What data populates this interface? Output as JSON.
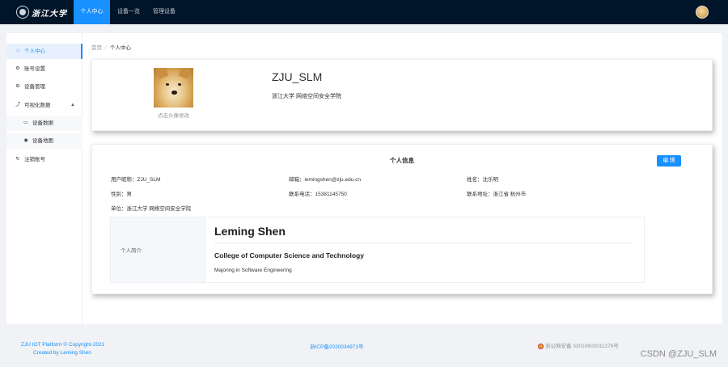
{
  "nav": {
    "logo_text": "浙江大学",
    "items": [
      "个人中心",
      "设备一览",
      "管理设备"
    ]
  },
  "sidebar": {
    "items": [
      {
        "label": "个人中心",
        "icon": "home-icon"
      },
      {
        "label": "账号设置",
        "icon": "gear-icon"
      },
      {
        "label": "设备管理",
        "icon": "gear-icon"
      },
      {
        "label": "可视化数据",
        "icon": "chart-icon"
      },
      {
        "label": "设备数据",
        "icon": "image-icon"
      },
      {
        "label": "设备地图",
        "icon": "location-icon"
      },
      {
        "label": "注销账号",
        "icon": "logout-icon"
      }
    ]
  },
  "breadcrumb": {
    "home": "首页",
    "sep": "/",
    "current": "个人中心"
  },
  "profile": {
    "avatar_hint": "点击头像修改",
    "username": "ZJU_SLM",
    "org": "浙江大学 网络空间安全学院"
  },
  "info": {
    "title": "个人信息",
    "edit_label": "编 辑",
    "fields": {
      "nickname": "用户昵称：ZJU_SLM",
      "email": "邮箱：lemingshen@zju.edu.cn",
      "name": "姓名：沈乐明",
      "gender": "性别：男",
      "phone": "联系电话：15381145750",
      "address": "联系地址：浙江省 杭州市",
      "unit": "单位：浙江大学 网络空间安全学院"
    },
    "intro_label": "个人简介",
    "intro_name": "Leming Shen",
    "intro_college": "College of Computer Science and Technology",
    "intro_major": "Majoring in Software Engineering"
  },
  "footer": {
    "copyright": "ZJU IOT Platform © Copyright-2021",
    "author": "Created by Leming Shen",
    "icp": "浙ICP备2020034971号",
    "police": "浙公网安备 33010602011276号",
    "watermark": "CSDN @ZJU_SLM"
  },
  "colors": {
    "accent": "#1890ff",
    "topbar": "#001529"
  }
}
